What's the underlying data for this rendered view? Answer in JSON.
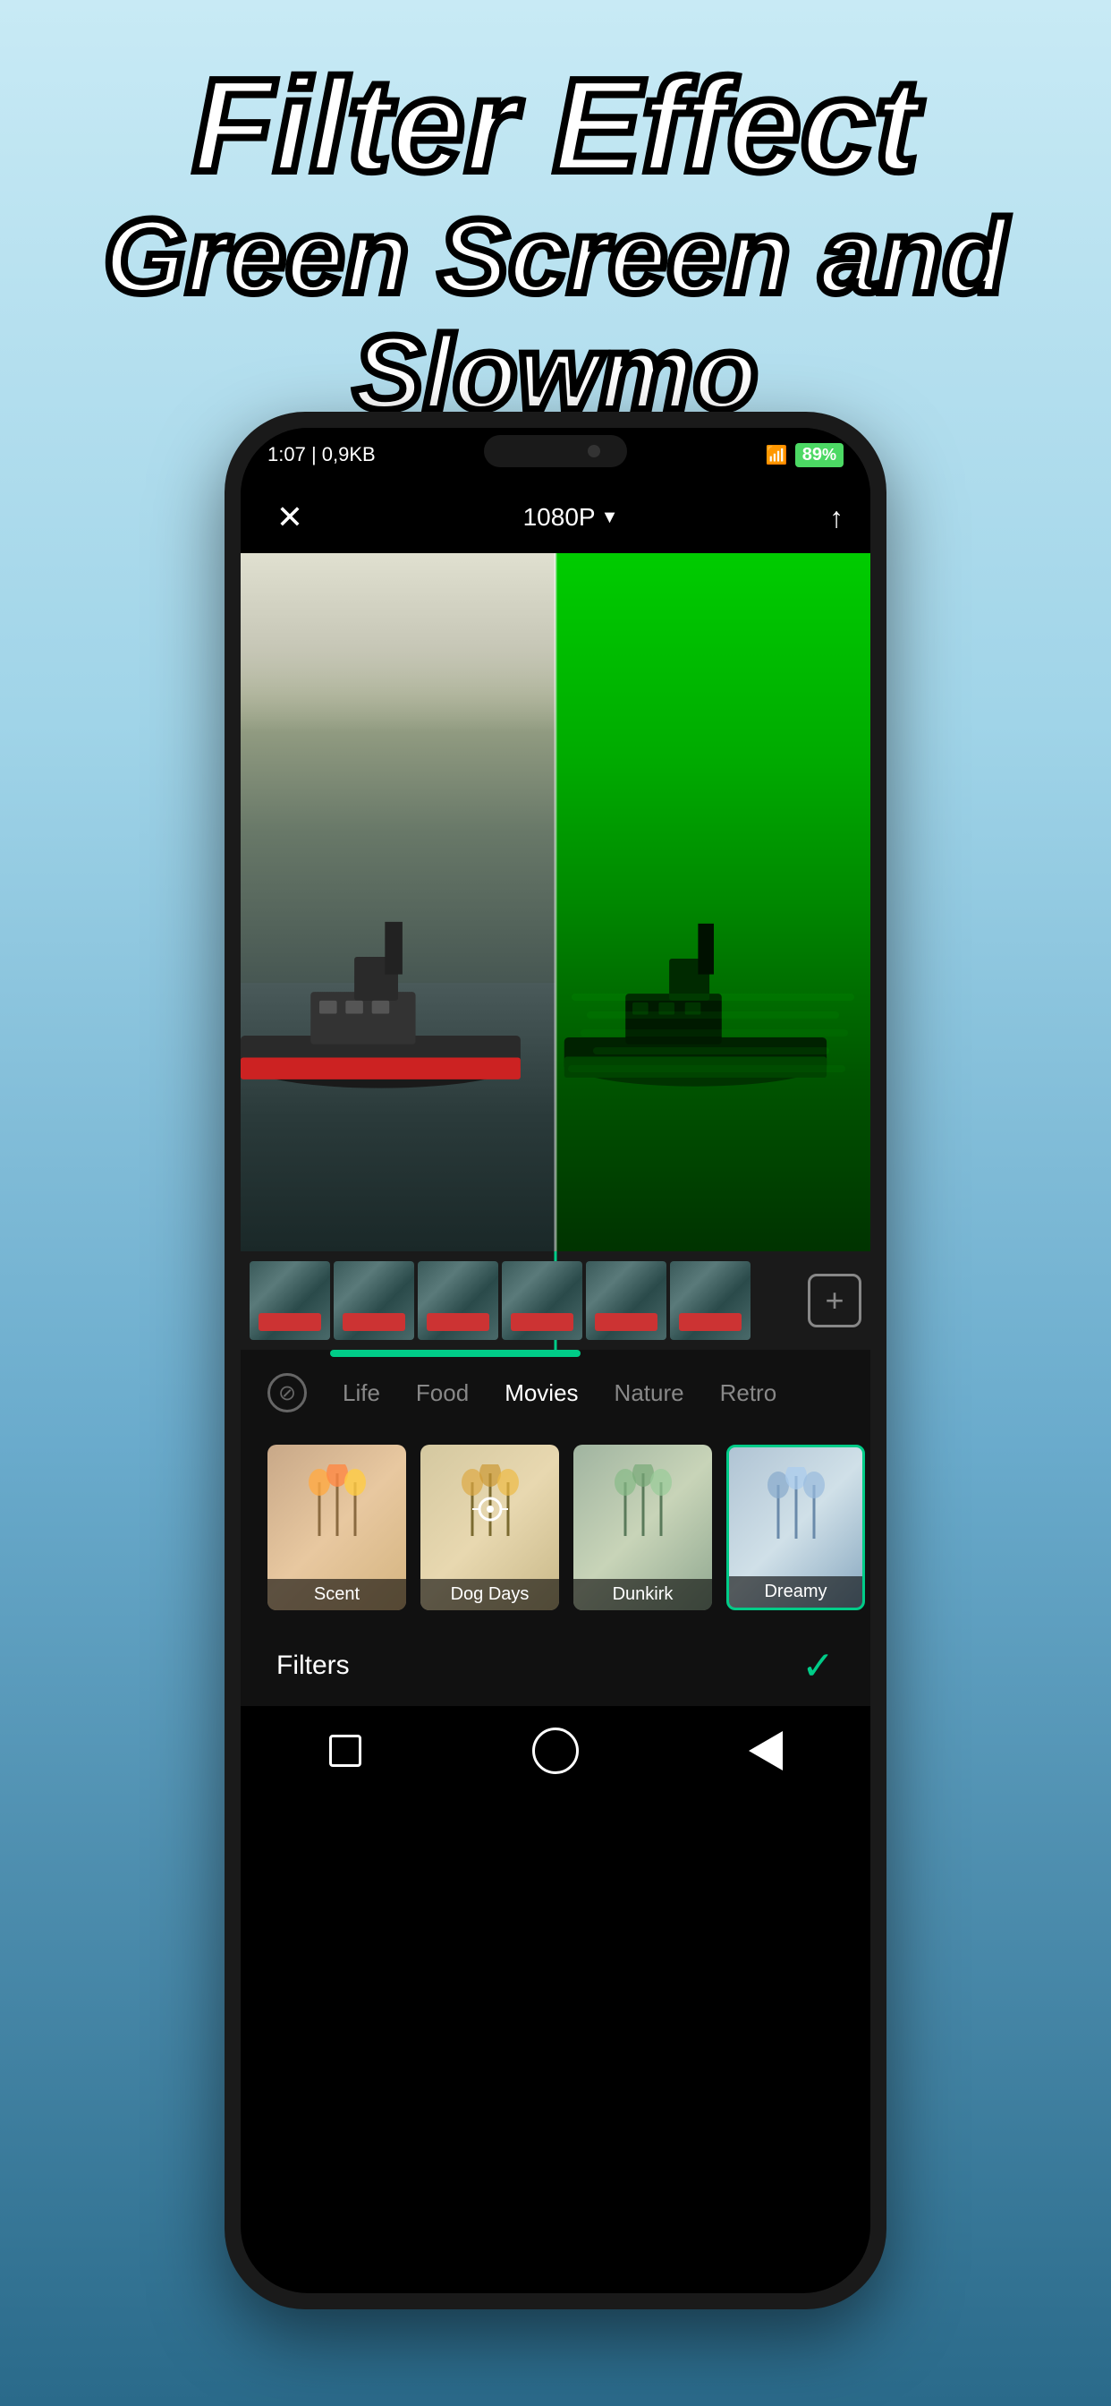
{
  "app": {
    "headline_line1": "Filter Effect",
    "headline_line2": "Green Screen and Slowmo"
  },
  "status_bar": {
    "time": "1:07",
    "data": "0,9KB",
    "network": "4G",
    "battery": "89"
  },
  "top_bar": {
    "resolution": "1080P",
    "resolution_arrow": "▼"
  },
  "filter_categories": {
    "items": [
      {
        "id": "none",
        "label": "⊘",
        "type": "icon"
      },
      {
        "id": "life",
        "label": "Life"
      },
      {
        "id": "food",
        "label": "Food"
      },
      {
        "id": "movies",
        "label": "Movies",
        "active": true
      },
      {
        "id": "nature",
        "label": "Nature"
      },
      {
        "id": "retro",
        "label": "Retro"
      }
    ]
  },
  "filter_items": [
    {
      "id": "scent",
      "label": "Scent"
    },
    {
      "id": "dogdays",
      "label": "Dog Days"
    },
    {
      "id": "dunkirk",
      "label": "Dunkirk"
    },
    {
      "id": "dreamy",
      "label": "Dreamy",
      "active": true
    }
  ],
  "bottom_section": {
    "filters_label": "Filters",
    "check_icon": "✓"
  },
  "icons": {
    "close": "✕",
    "upload": "↑",
    "add": "+"
  }
}
